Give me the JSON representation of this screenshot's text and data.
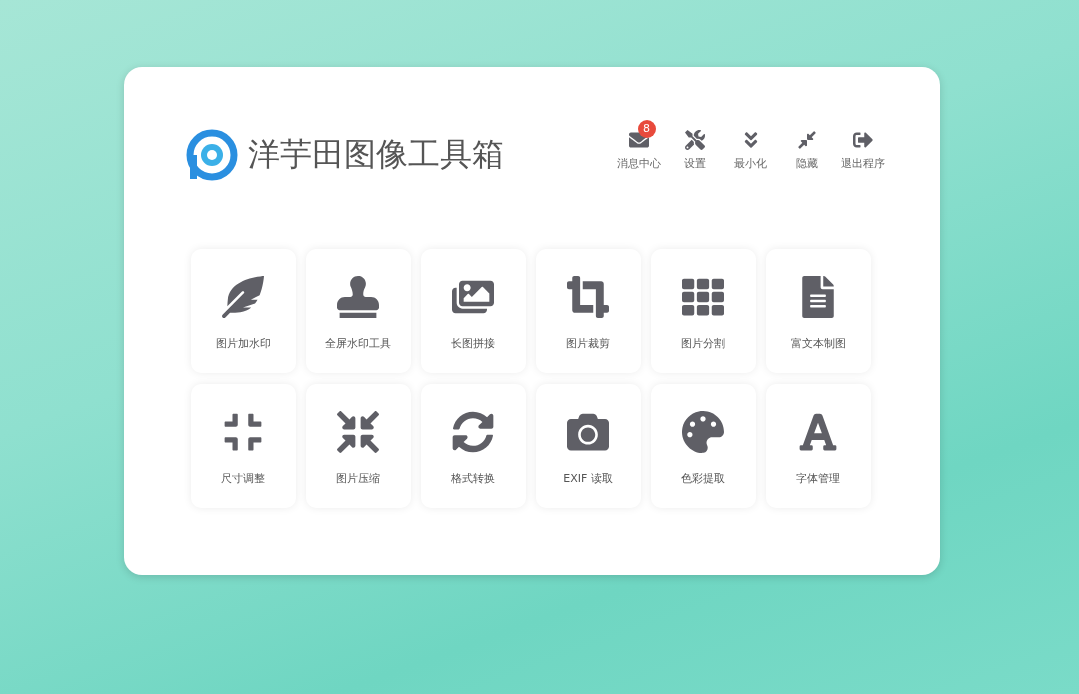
{
  "app": {
    "title": "洋芋田图像工具箱"
  },
  "header_actions": [
    {
      "label": "消息中心",
      "badge": "8"
    },
    {
      "label": "设置"
    },
    {
      "label": "最小化"
    },
    {
      "label": "隐藏"
    },
    {
      "label": "退出程序"
    }
  ],
  "tools": [
    {
      "label": "图片加水印"
    },
    {
      "label": "全屏水印工具"
    },
    {
      "label": "长图拼接"
    },
    {
      "label": "图片裁剪"
    },
    {
      "label": "图片分割"
    },
    {
      "label": "富文本制图"
    },
    {
      "label": "尺寸调整"
    },
    {
      "label": "图片压缩"
    },
    {
      "label": "格式转换"
    },
    {
      "label": "EXIF 读取"
    },
    {
      "label": "色彩提取"
    },
    {
      "label": "字体管理"
    }
  ]
}
